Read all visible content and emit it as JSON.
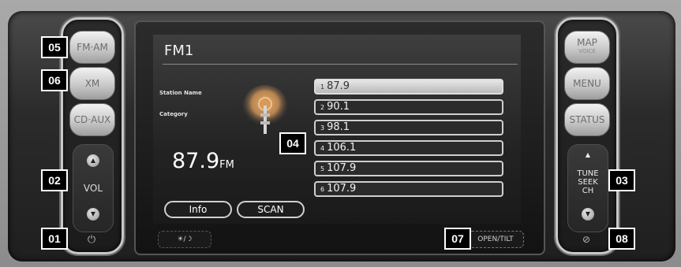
{
  "screen": {
    "title": "FM1",
    "station_name_label": "Station Name",
    "category_label": "Category",
    "frequency": "87.9",
    "band": "FM",
    "presets": [
      {
        "num": "1",
        "freq": "87.9",
        "active": true
      },
      {
        "num": "2",
        "freq": "90.1",
        "active": false
      },
      {
        "num": "3",
        "freq": "98.1",
        "active": false
      },
      {
        "num": "4",
        "freq": "106.1",
        "active": false
      },
      {
        "num": "5",
        "freq": "107.9",
        "active": false
      },
      {
        "num": "6",
        "freq": "107.9",
        "active": false
      }
    ],
    "info_button": "Info",
    "scan_button": "SCAN"
  },
  "left_panel": {
    "fm_am": "FM·AM",
    "xm": "XM",
    "cd_aux": "CD·AUX",
    "vol": "VOL"
  },
  "right_panel": {
    "map": "MAP",
    "voice": "VOICE",
    "menu": "MENU",
    "status": "STATUS",
    "tune": "TUNE",
    "seek": "SEEK",
    "ch": "CH"
  },
  "bezel": {
    "brightness": "☀/☽",
    "open_tilt": "OPEN/TILT"
  },
  "callouts": [
    "01",
    "02",
    "03",
    "04",
    "05",
    "06",
    "07",
    "08"
  ]
}
